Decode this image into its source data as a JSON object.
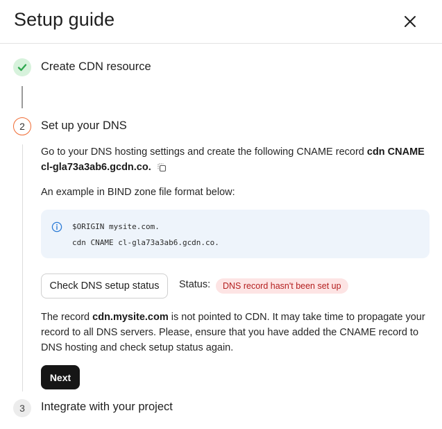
{
  "header": {
    "title": "Setup guide",
    "close_icon": "close-icon"
  },
  "steps": [
    {
      "number": "1",
      "title": "Create CDN resource",
      "state": "done",
      "icon": "checkmark-icon"
    },
    {
      "number": "2",
      "title": "Set up your DNS",
      "state": "active"
    },
    {
      "number": "3",
      "title": "Integrate with your project",
      "state": "pending"
    }
  ],
  "dns": {
    "instruction_prefix": "Go to your DNS hosting settings and create the following CNAME record ",
    "record_bold": "cdn CNAME cl-gla73a3ab6.gcdn.co.",
    "copy_icon": "copy-icon",
    "example_text": "An example in BIND zone file format below:",
    "code_lines": [
      "$ORIGIN mysite.com.",
      "cdn CNAME cl-gla73a3ab6.gcdn.co."
    ],
    "info_icon": "info-icon",
    "check_button": "Check DNS setup status",
    "status_label": "Status:",
    "status_badge": "DNS record hasn't been set up",
    "message_prefix": "The record ",
    "message_bold": "cdn.mysite.com",
    "message_suffix": " is not pointed to CDN. It may take time to propagate your record to all DNS servers. Please, ensure that you have added the CNAME record to DNS hosting and check setup status again.",
    "next_button": "Next"
  },
  "colors": {
    "accent_orange": "#f06b33",
    "done_green": "#2fa84f",
    "done_bg": "#d7f2dc",
    "code_bg": "#eef4fb",
    "badge_bg": "#fde4e4",
    "badge_text": "#b42020",
    "primary_button": "#161616"
  }
}
